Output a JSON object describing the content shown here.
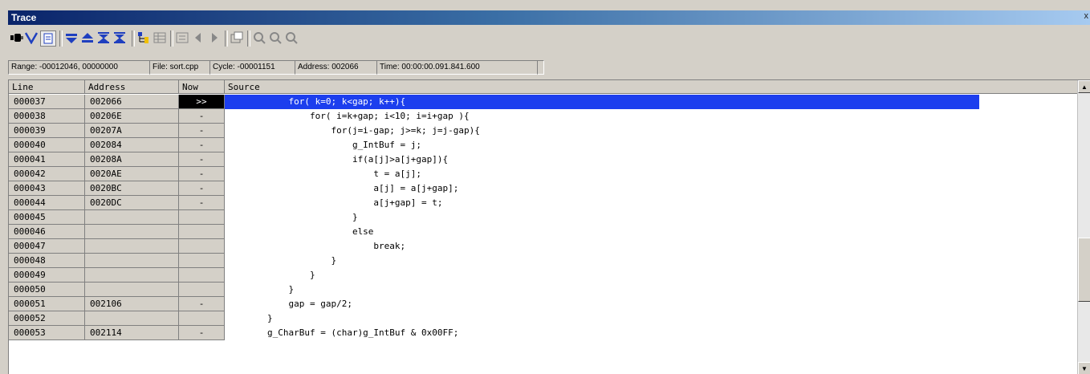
{
  "window": {
    "title": "Trace",
    "close_glyph": "x"
  },
  "toolbar": {
    "icons": [
      "record-icon",
      "filter-icon",
      "document-icon",
      "arrow-down-icon",
      "arrow-up-icon",
      "expand-icon",
      "collapse-icon",
      "tree-icon",
      "grid-icon",
      "frame-icon",
      "prev-icon",
      "next-icon",
      "properties-icon",
      "zoom-icon",
      "zoom-in-icon",
      "zoom-out-icon"
    ]
  },
  "status": {
    "range": "Range: -00012046, 00000000",
    "file": "File: sort.cpp",
    "cycle": "Cycle: -00001151",
    "address": "Address: 002066",
    "time": "Time: 00:00:00.091.841.600"
  },
  "columns": {
    "line": "Line",
    "address": "Address",
    "now": "Now",
    "source": "Source"
  },
  "rows": [
    {
      "line": "000037",
      "address": "002066",
      "now": ">>",
      "source": "            for( k=0; k<gap; k++){"
    },
    {
      "line": "000038",
      "address": "00206E",
      "now": "-",
      "source": "                for( i=k+gap; i<10; i=i+gap ){"
    },
    {
      "line": "000039",
      "address": "00207A",
      "now": "-",
      "source": "                    for(j=i-gap; j>=k; j=j-gap){"
    },
    {
      "line": "000040",
      "address": "002084",
      "now": "-",
      "source": "                        g_IntBuf = j;"
    },
    {
      "line": "000041",
      "address": "00208A",
      "now": "-",
      "source": "                        if(a[j]>a[j+gap]){"
    },
    {
      "line": "000042",
      "address": "0020AE",
      "now": "-",
      "source": "                            t = a[j];"
    },
    {
      "line": "000043",
      "address": "0020BC",
      "now": "-",
      "source": "                            a[j] = a[j+gap];"
    },
    {
      "line": "000044",
      "address": "0020DC",
      "now": "-",
      "source": "                            a[j+gap] = t;"
    },
    {
      "line": "000045",
      "address": "",
      "now": "",
      "source": "                        }"
    },
    {
      "line": "000046",
      "address": "",
      "now": "",
      "source": "                        else"
    },
    {
      "line": "000047",
      "address": "",
      "now": "",
      "source": "                            break;"
    },
    {
      "line": "000048",
      "address": "",
      "now": "",
      "source": "                    }"
    },
    {
      "line": "000049",
      "address": "",
      "now": "",
      "source": "                }"
    },
    {
      "line": "000050",
      "address": "",
      "now": "",
      "source": "            }"
    },
    {
      "line": "000051",
      "address": "002106",
      "now": "-",
      "source": "            gap = gap/2;"
    },
    {
      "line": "000052",
      "address": "",
      "now": "",
      "source": "        }"
    },
    {
      "line": "000053",
      "address": "002114",
      "now": "-",
      "source": "        g_CharBuf = (char)g_IntBuf & 0x00FF;"
    }
  ],
  "scrollbar": {
    "up_glyph": "▲",
    "down_glyph": "▼"
  }
}
